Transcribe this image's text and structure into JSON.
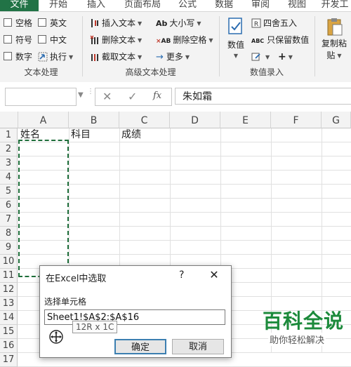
{
  "ribbon_tabs": [
    "文件",
    "开始",
    "插入",
    "页面布局",
    "公式",
    "数据",
    "审阅",
    "视图",
    "开发工"
  ],
  "text_processing": {
    "items": [
      "空格",
      "英文",
      "符号",
      "中文",
      "数字",
      "执行"
    ],
    "group_label": "文本处理"
  },
  "advanced_text": {
    "items": [
      "插入文本",
      "大小写",
      "删除文本",
      "删除空格",
      "截取文本",
      "更多"
    ],
    "group_label": "高级文本处理",
    "ab_text": "Ab",
    "ab2_text": "AB"
  },
  "numeric_entry": {
    "big_button": "数值",
    "items": [
      "四舍五入",
      "只保留数值"
    ],
    "group_label": "数值录入",
    "abc_text": "ABC"
  },
  "copy_paste": {
    "line1": "复制粘",
    "line2": "贴"
  },
  "formula_bar": {
    "fx": "fx",
    "content": "朱如霜"
  },
  "sheet": {
    "columns": [
      "A",
      "B",
      "C",
      "D",
      "E",
      "F",
      "G"
    ],
    "rows": [
      "1",
      "2",
      "3",
      "4",
      "5",
      "6",
      "7",
      "8",
      "9",
      "10",
      "11",
      "12",
      "13",
      "14",
      "15",
      "16",
      "17"
    ],
    "row1": [
      "姓名",
      "科目",
      "成绩"
    ]
  },
  "dialog": {
    "title": "在Excel中选取",
    "help": "?",
    "label": "选择单元格",
    "input_value": "Sheet1!$A$2:$A$16",
    "tooltip": "12R x 1C",
    "ok": "确定",
    "cancel": "取消"
  },
  "watermark": {
    "main": "百科全说",
    "sub": "助你轻松解决"
  },
  "colors": {
    "excel_green": "#217346",
    "marquee": "#1e6e3a",
    "watermark": "#1c8a3b"
  }
}
